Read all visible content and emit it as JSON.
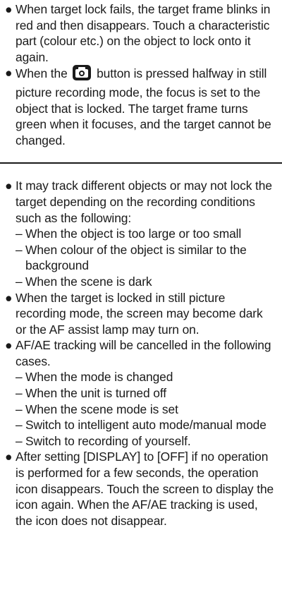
{
  "section1": {
    "bullet1": "When target lock fails, the target frame blinks in red and then disappears. Touch a characteristic part (colour etc.) on the object to lock onto it again.",
    "bullet2_before_icon": "When the",
    "bullet2_after_icon": "button is pressed halfway in still picture recording mode, the focus is set to the object that is locked. The target frame turns green when it focuses, and the target cannot be changed.",
    "camera_icon": "camera-button-icon"
  },
  "section2": {
    "bullet1": {
      "text": "It may track different objects or may not lock the target depending on the recording conditions such as the following:",
      "subitems": [
        "When the object is too large or too small",
        "When colour of the object is similar to the background",
        "When the scene is dark"
      ]
    },
    "bullet2": "When the target is locked in still picture recording mode, the screen may become dark or the AF assist lamp may turn on.",
    "bullet3": {
      "text": "AF/AE tracking will be cancelled in the following cases.",
      "subitems": [
        "When the mode is changed",
        "When the unit is turned off",
        "When the scene mode is set",
        "Switch to intelligent auto mode/manual mode",
        "Switch to recording of yourself."
      ]
    },
    "bullet4": "After setting [DISPLAY] to [OFF] if no operation is performed for a few seconds, the operation icon disappears. Touch the screen to display the icon again. When the AF/AE tracking is used, the icon does not disappear."
  },
  "symbols": {
    "bullet": "●",
    "dash": "–"
  }
}
